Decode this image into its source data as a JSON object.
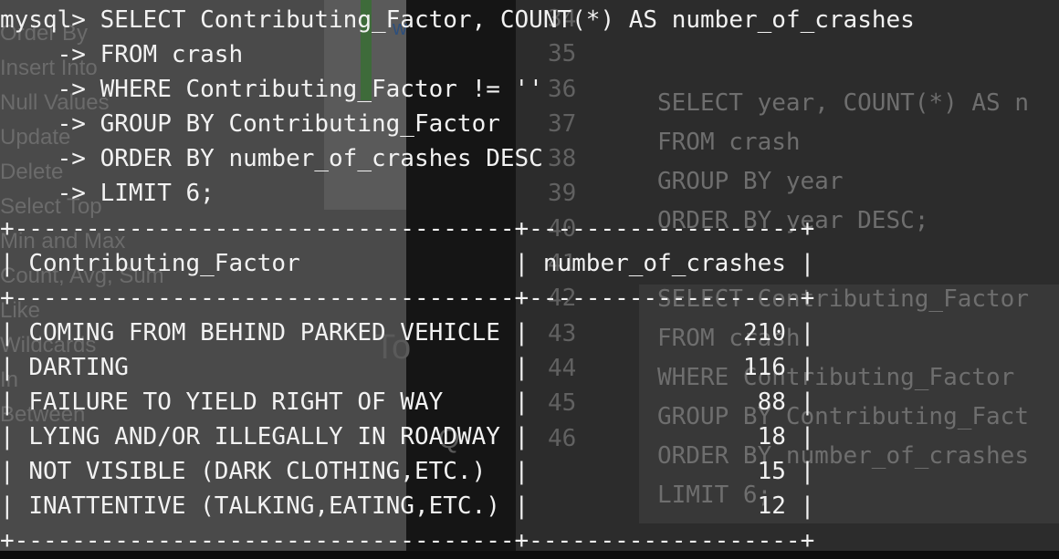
{
  "background": {
    "sidebar_items": [
      "Order By",
      "Insert Into",
      "Null Values",
      "Update",
      "Delete",
      "Select Top",
      "Min and Max",
      "Count, Avg, Sum",
      "Like",
      "Wildcards",
      "In",
      "Between"
    ],
    "line_numbers": [
      "34",
      "35",
      "36",
      "37",
      "38",
      "39",
      "40",
      "41",
      "42",
      "43",
      "44",
      "45",
      "46"
    ],
    "code_lines": [
      "SELECT year, COUNT(*) AS n",
      "FROM crash",
      "GROUP BY year",
      "ORDER BY year DESC;",
      "",
      "SELECT Contributing_Factor",
      "FROM crash",
      "WHERE Contributing_Factor",
      "GROUP BY Contributing_Fact",
      "ORDER BY number_of_crashes",
      "LIMIT 6;"
    ],
    "ghost_to": "To",
    "ghost_w": "w",
    "ghost_q": "Q"
  },
  "terminal": {
    "prompt": "mysql> ",
    "continuation": "    -> ",
    "query_lines": [
      "SELECT Contributing_Factor, COUNT(*) AS number_of_crashes",
      "FROM crash",
      "WHERE Contributing_Factor != ''",
      "GROUP BY Contributing_Factor",
      "ORDER BY number_of_crashes DESC",
      "LIMIT 6;"
    ],
    "columns": [
      "Contributing_Factor",
      "number_of_crashes"
    ],
    "rows": [
      [
        "COMING FROM BEHIND PARKED VEHICLE",
        "210"
      ],
      [
        "DARTING",
        "116"
      ],
      [
        "FAILURE TO YIELD RIGHT OF WAY",
        "88"
      ],
      [
        "LYING AND/OR ILLEGALLY IN ROADWAY",
        "18"
      ],
      [
        "NOT VISIBLE (DARK CLOTHING,ETC.)",
        "15"
      ],
      [
        "INATTENTIVE (TALKING,EATING,ETC.)",
        "12"
      ]
    ]
  }
}
